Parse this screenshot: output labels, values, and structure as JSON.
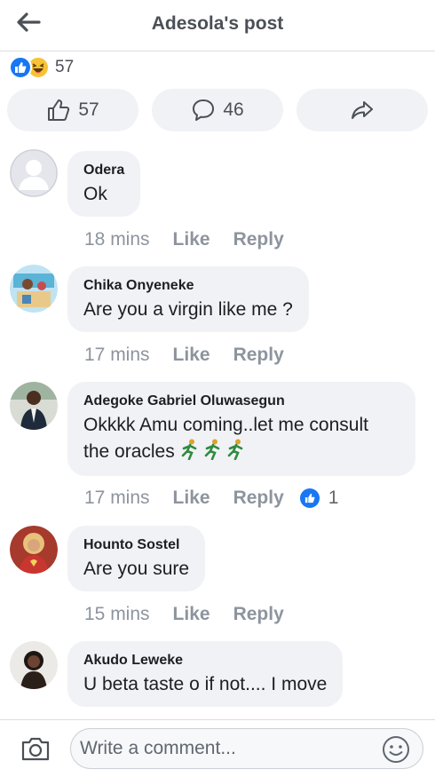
{
  "header": {
    "title": "Adesola's post"
  },
  "reactions": {
    "count": "57"
  },
  "actions": {
    "likes": "57",
    "comments": "46"
  },
  "comments": [
    {
      "author": "Odera",
      "text": "Ok",
      "time": "18 mins",
      "like": "Like",
      "reply": "Reply"
    },
    {
      "author": "Chika Onyeneke",
      "text": "Are you a virgin like me ?",
      "time": "17 mins",
      "like": "Like",
      "reply": "Reply"
    },
    {
      "author": "Adegoke Gabriel Oluwasegun",
      "text_line1": "Okkkk Amu coming..let me consult",
      "text_line2": "the oracles",
      "time": "17 mins",
      "like": "Like",
      "reply": "Reply",
      "reaction_count": "1"
    },
    {
      "author": "Hounto Sostel",
      "text": "Are you sure",
      "time": "15 mins",
      "like": "Like",
      "reply": "Reply"
    },
    {
      "author": "Akudo Leweke",
      "text": "U beta taste o if not.... I move"
    }
  ],
  "composer": {
    "placeholder": "Write a comment..."
  },
  "colors": {
    "accent": "#1877f2",
    "bubble": "#f0f2f5",
    "muted": "#8d949e"
  },
  "icons": [
    "back-arrow-icon",
    "like-icon",
    "haha-icon",
    "comment-icon",
    "share-icon",
    "camera-icon",
    "smiley-icon",
    "running-person-icon"
  ]
}
